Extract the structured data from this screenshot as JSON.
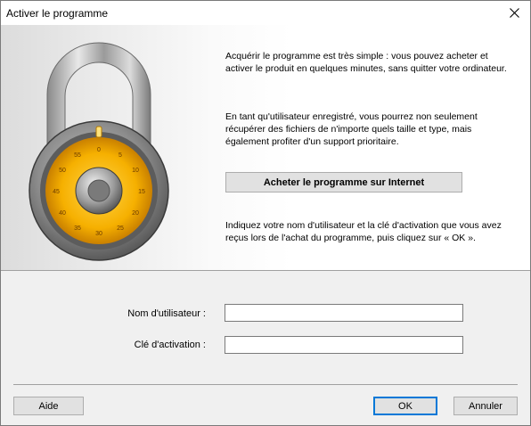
{
  "window": {
    "title": "Activer le programme"
  },
  "banner": {
    "paragraph1": "Acquérir le programme est très simple : vous pouvez acheter et activer le produit en quelques minutes, sans quitter votre ordinateur.",
    "paragraph2": "En tant qu'utilisateur enregistré, vous pourrez non seulement récupérer des fichiers de n'importe quels taille et type, mais également profiter d'un support prioritaire.",
    "buy_button": "Acheter le programme sur Internet",
    "paragraph3": "Indiquez votre nom d'utilisateur et la clé d'activation que vous avez reçus lors de l'achat du programme, puis cliquez sur « OK ».",
    "lock_dial_numbers": [
      "0",
      "5",
      "10",
      "15",
      "20",
      "25",
      "30",
      "35",
      "40",
      "45",
      "50",
      "55"
    ]
  },
  "form": {
    "username_label": "Nom d'utilisateur :",
    "username_value": "",
    "key_label": "Clé d'activation :",
    "key_value": ""
  },
  "footer": {
    "help_label": "Aide",
    "ok_label": "OK",
    "cancel_label": "Annuler"
  },
  "icons": {
    "close": "close-icon",
    "lock": "padlock-icon"
  },
  "colors": {
    "dial_outer": "#f0a400",
    "dial_inner": "#ffd54a",
    "ok_border": "#0078d7"
  }
}
